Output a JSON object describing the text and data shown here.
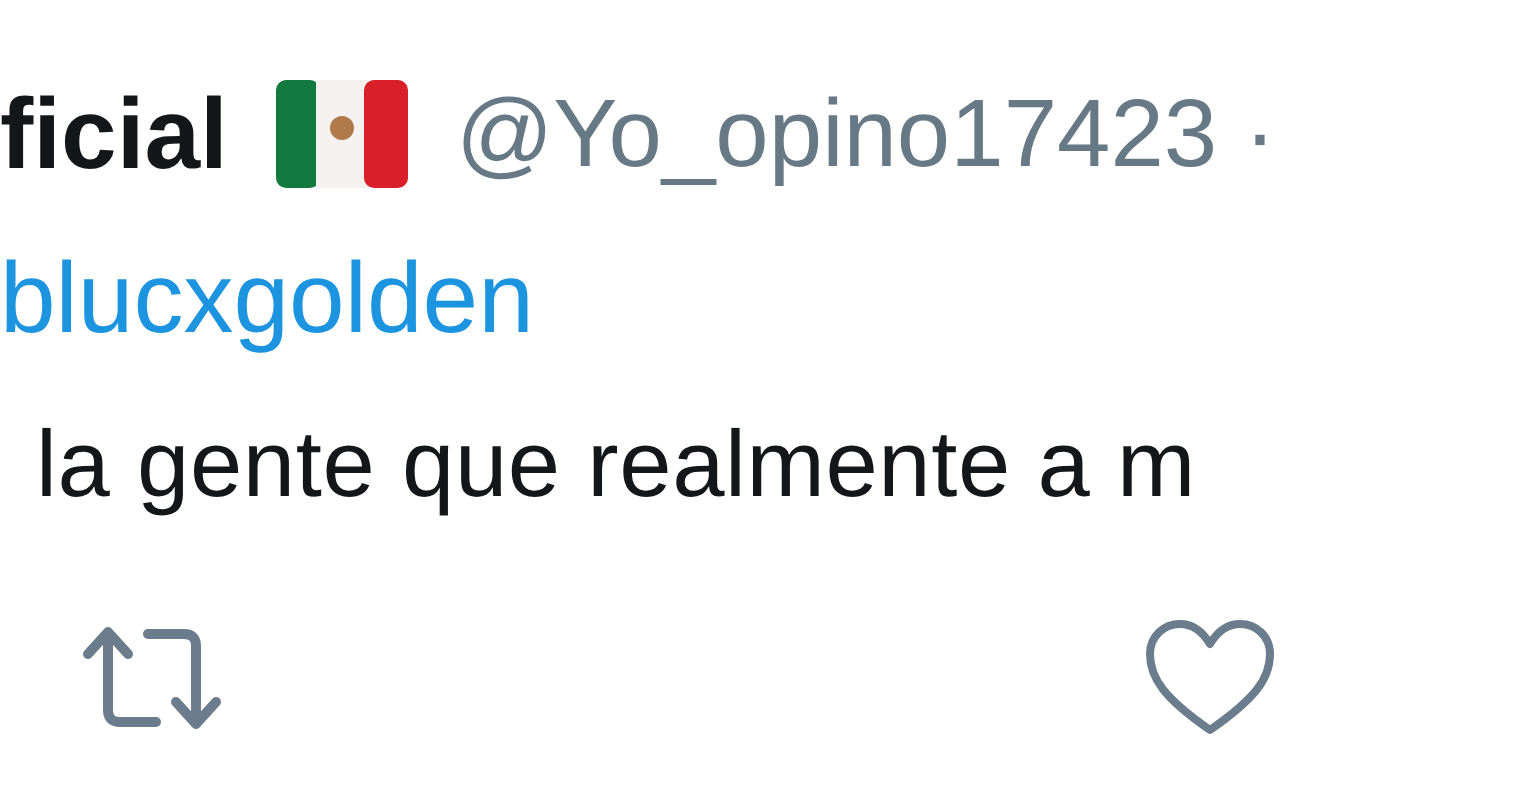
{
  "tweet": {
    "display_name": "ficial",
    "handle": "@Yo_opino17423 ·",
    "reply_to": "blucxgolden",
    "text": "la gente que realmente a m"
  }
}
